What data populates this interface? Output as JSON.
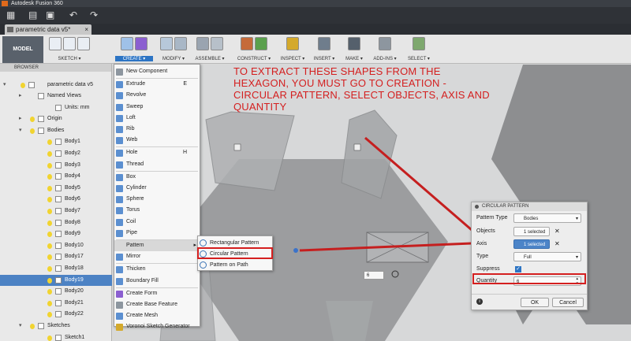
{
  "titlebar": {
    "title": "Autodesk Fusion 360"
  },
  "document_tab": {
    "name": "parametric data v5*"
  },
  "workspace": {
    "label": "MODEL"
  },
  "toolbar": {
    "groups": [
      {
        "label": "SKETCH",
        "colors": [
          "#e9eef4",
          "#e9eef4",
          "#e9eef4"
        ]
      },
      {
        "label": "CREATE",
        "colors": [
          "#9fc1e8",
          "#8b5fd0"
        ]
      },
      {
        "label": "MODIFY",
        "colors": [
          "#b7c8da",
          "#a9b7c6"
        ]
      },
      {
        "label": "ASSEMBLE",
        "colors": [
          "#9aa4b0",
          "#b7c0c9"
        ]
      },
      {
        "label": "CONSTRUCT",
        "colors": [
          "#c56b3a",
          "#5aa04d"
        ]
      },
      {
        "label": "INSPECT",
        "colors": [
          "#d4a92b"
        ]
      },
      {
        "label": "INSERT",
        "colors": [
          "#6f7d8c"
        ]
      },
      {
        "label": "MAKE",
        "colors": [
          "#55606c"
        ]
      },
      {
        "label": "ADD-INS",
        "colors": [
          "#8d969f"
        ]
      },
      {
        "label": "SELECT",
        "colors": [
          "#7ea86e"
        ]
      }
    ]
  },
  "browser": {
    "header": "BROWSER",
    "root": "parametric data v5",
    "items": [
      {
        "label": "Named Views",
        "indent": 1,
        "bulb": false
      },
      {
        "label": "Units: mm",
        "indent": 2,
        "bulb": false
      },
      {
        "label": "Origin",
        "indent": 1,
        "bulb": true
      },
      {
        "label": "Bodies",
        "indent": 1,
        "bulb": true
      },
      {
        "label": "Body1",
        "indent": 2,
        "bulb": true
      },
      {
        "label": "Body2",
        "indent": 2,
        "bulb": true
      },
      {
        "label": "Body3",
        "indent": 2,
        "bulb": true
      },
      {
        "label": "Body4",
        "indent": 2,
        "bulb": true
      },
      {
        "label": "Body5",
        "indent": 2,
        "bulb": true
      },
      {
        "label": "Body6",
        "indent": 2,
        "bulb": true
      },
      {
        "label": "Body7",
        "indent": 2,
        "bulb": true
      },
      {
        "label": "Body8",
        "indent": 2,
        "bulb": true
      },
      {
        "label": "Body9",
        "indent": 2,
        "bulb": true
      },
      {
        "label": "Body10",
        "indent": 2,
        "bulb": true
      },
      {
        "label": "Body17",
        "indent": 2,
        "bulb": true
      },
      {
        "label": "Body18",
        "indent": 2,
        "bulb": true
      },
      {
        "label": "Body19",
        "indent": 2,
        "bulb": true,
        "selected": true
      },
      {
        "label": "Body20",
        "indent": 2,
        "bulb": true
      },
      {
        "label": "Body21",
        "indent": 2,
        "bulb": true
      },
      {
        "label": "Body22",
        "indent": 2,
        "bulb": true
      },
      {
        "label": "Sketches",
        "indent": 1,
        "bulb": true
      },
      {
        "label": "Sketch1",
        "indent": 2,
        "bulb": true
      }
    ]
  },
  "create_menu": {
    "items": [
      {
        "label": "New Component",
        "shortcut": "",
        "color": "#8d969f"
      },
      {
        "label": "Extrude",
        "shortcut": "E",
        "color": "#5b8fd0"
      },
      {
        "label": "Revolve",
        "shortcut": "",
        "color": "#5b8fd0"
      },
      {
        "label": "Sweep",
        "shortcut": "",
        "color": "#5b8fd0"
      },
      {
        "label": "Loft",
        "shortcut": "",
        "color": "#5b8fd0"
      },
      {
        "label": "Rib",
        "shortcut": "",
        "color": "#5b8fd0"
      },
      {
        "label": "Web",
        "shortcut": "",
        "color": "#5b8fd0"
      },
      {
        "label": "Hole",
        "shortcut": "H",
        "color": "#5b8fd0"
      },
      {
        "label": "Thread",
        "shortcut": "",
        "color": "#5b8fd0"
      },
      {
        "label": "Box",
        "shortcut": "",
        "color": "#5b8fd0"
      },
      {
        "label": "Cylinder",
        "shortcut": "",
        "color": "#5b8fd0"
      },
      {
        "label": "Sphere",
        "shortcut": "",
        "color": "#5b8fd0"
      },
      {
        "label": "Torus",
        "shortcut": "",
        "color": "#5b8fd0"
      },
      {
        "label": "Coil",
        "shortcut": "",
        "color": "#5b8fd0"
      },
      {
        "label": "Pipe",
        "shortcut": "",
        "color": "#5b8fd0"
      },
      {
        "label": "Pattern",
        "shortcut": "",
        "color": "",
        "submenu": true
      },
      {
        "label": "Mirror",
        "shortcut": "",
        "color": "#5b8fd0"
      },
      {
        "label": "Thicken",
        "shortcut": "",
        "color": "#5b8fd0"
      },
      {
        "label": "Boundary Fill",
        "shortcut": "",
        "color": "#5b8fd0"
      },
      {
        "label": "Create Form",
        "shortcut": "",
        "color": "#8b5fd0"
      },
      {
        "label": "Create Base Feature",
        "shortcut": "",
        "color": "#8d969f"
      },
      {
        "label": "Create Mesh",
        "shortcut": "",
        "color": "#5b8fd0"
      },
      {
        "label": "Voronoi Sketch Generator",
        "shortcut": "",
        "color": "#d4a92b"
      }
    ]
  },
  "pattern_submenu": {
    "items": [
      {
        "label": "Rectangular Pattern"
      },
      {
        "label": "Circular Pattern",
        "highlighted": true
      },
      {
        "label": "Pattern on Path"
      }
    ]
  },
  "annotation": {
    "text": "TO EXTRACT THESE SHAPES FROM THE HEXAGON, YOU MUST GO TO CREATION - CIRCULAR PATTERN, SELECT OBJECTS, AXIS AND QUANTITY",
    "color": "#d41f1f"
  },
  "quantity_badge": {
    "value": "6"
  },
  "dialog": {
    "title": "CIRCULAR PATTERN",
    "pattern_type": {
      "label": "Pattern Type",
      "value": "Bodies"
    },
    "objects": {
      "label": "Objects",
      "value": "1 selected"
    },
    "axis": {
      "label": "Axis",
      "value": "1 selected"
    },
    "type": {
      "label": "Type",
      "value": "Full"
    },
    "suppress": {
      "label": "Suppress",
      "checked": true
    },
    "quantity": {
      "label": "Quantity",
      "value": "6"
    },
    "ok": "OK",
    "cancel": "Cancel"
  }
}
